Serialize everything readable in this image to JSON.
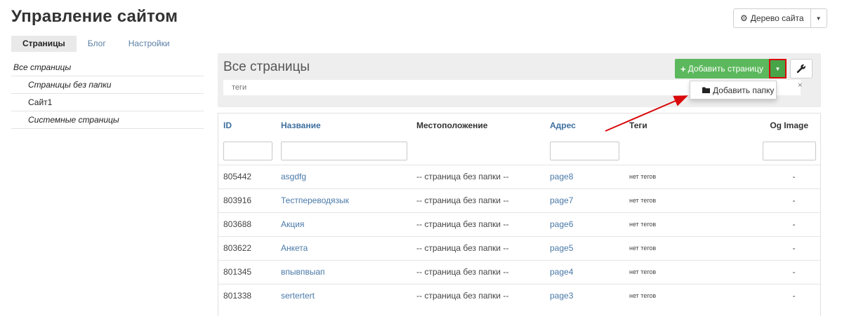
{
  "header": {
    "title": "Управление сайтом",
    "site_tree_label": "Дерево сайта"
  },
  "tabs": [
    "Страницы",
    "Блог",
    "Настройки"
  ],
  "sidebar": {
    "items": [
      {
        "label": "Все страницы"
      },
      {
        "label": "Страницы без папки"
      },
      {
        "label": "Сайт1"
      },
      {
        "label": "Системные страницы"
      }
    ]
  },
  "panel": {
    "title": "Все страницы",
    "tags_placeholder": "теги",
    "clear_symbol": "×",
    "add_page_label": "Добавить страницу",
    "add_folder_label": "Добавить папку"
  },
  "table": {
    "columns": [
      "ID",
      "Название",
      "Местоположение",
      "Адрес",
      "Теги",
      "Og Image"
    ],
    "rows": [
      {
        "id": "805442",
        "name": "asgdfg",
        "location": "-- страница без папки --",
        "address": "page8",
        "tags": "нет тегов",
        "og": "-"
      },
      {
        "id": "803916",
        "name": "Тестпереводязык",
        "location": "-- страница без папки --",
        "address": "page7",
        "tags": "нет тегов",
        "og": "-"
      },
      {
        "id": "803688",
        "name": "Акция",
        "location": "-- страница без папки --",
        "address": "page6",
        "tags": "нет тегов",
        "og": "-"
      },
      {
        "id": "803622",
        "name": "Анкета",
        "location": "-- страница без папки --",
        "address": "page5",
        "tags": "нет тегов",
        "og": "-"
      },
      {
        "id": "801345",
        "name": "впывпвыап",
        "location": "-- страница без папки --",
        "address": "page4",
        "tags": "нет тегов",
        "og": "-"
      },
      {
        "id": "801338",
        "name": "sertertert",
        "location": "-- страница без папки --",
        "address": "page3",
        "tags": "нет тегов",
        "og": "-"
      }
    ]
  },
  "colors": {
    "accent_green": "#5cb85c",
    "highlight_red": "#d9090b",
    "link_blue": "#4a79a8"
  },
  "icons": {
    "gear": "gear-icon",
    "caret": "caret-down-icon",
    "plus": "plus-icon",
    "folder": "folder-icon",
    "wrench": "wrench-icon"
  }
}
